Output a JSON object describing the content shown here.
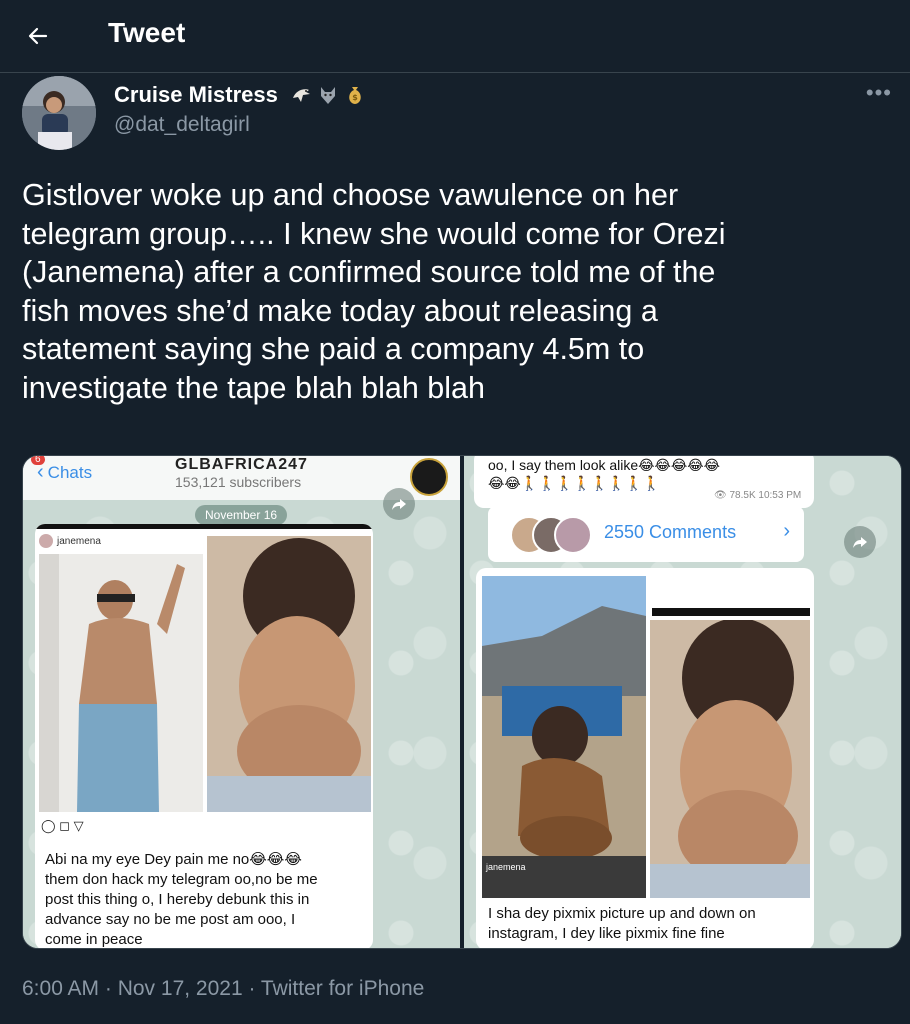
{
  "header": {
    "title": "Tweet",
    "back_icon": "arrow-left-icon"
  },
  "author": {
    "name": "Cruise Mistress",
    "handle": "@dat_deltagirl",
    "emojis": [
      "eagle-icon",
      "wolf-icon",
      "money-bag-icon"
    ]
  },
  "tweet": {
    "lines": [
      "Gistlover woke up and choose vawulence on her",
      "telegram group….. I knew she would come for Orezi",
      "(Janemena) after a confirmed source told me of the",
      "fish moves she’d make today about releasing a",
      "statement saying she paid a company 4.5m to",
      "investigate the tape blah blah blah"
    ]
  },
  "media": {
    "left": {
      "back_label": "Chats",
      "badge": "6",
      "channel_title": "GLBAFRICA247",
      "subscribers": "153,121 subscribers",
      "date_pill": "November 16",
      "ig_user": "janemena",
      "caption_lines": [
        "Abi na my eye Dey pain me no😂😂😂",
        "them don hack my telegram oo,no be me",
        "post this thing o, I hereby debunk this in",
        "advance say no be me post am ooo, I",
        "come in peace"
      ]
    },
    "right": {
      "top_lines": [
        "oo, I say them look alike😂😂😂😂😂",
        "😂😂🚶🚶🚶🚶🚶🚶🚶🚶"
      ],
      "views_meta": "78.5K 10:53 PM",
      "comments_label": "2550 Comments",
      "ig_user": "janemena",
      "caption_lines": [
        "I sha dey pixmix picture up and down on",
        "instagram, I dey like pixmix fine fine"
      ]
    }
  },
  "footer": {
    "meta": "6:00 AM · Nov 17, 2021 · Twitter for iPhone"
  },
  "colors": {
    "background": "#15202b",
    "text": "#ffffff",
    "muted": "#8b98a5",
    "link": "#3a8ee6"
  }
}
